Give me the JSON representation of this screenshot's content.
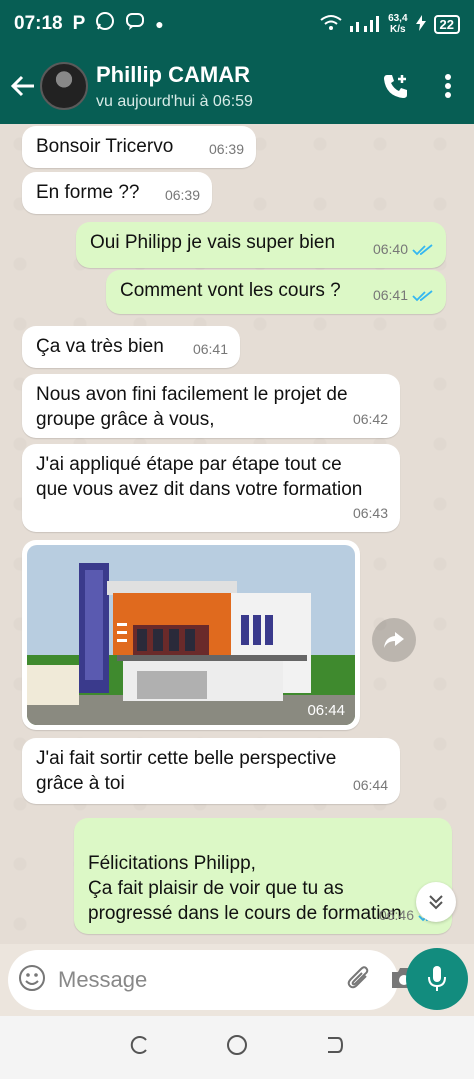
{
  "status_bar": {
    "time": "07:18",
    "speed_value": "63,4",
    "speed_unit": "K/s",
    "battery": "22"
  },
  "header": {
    "contact_name": "Phillip CAMAR",
    "last_seen": "vu aujourd'hui à 06:59"
  },
  "messages": [
    {
      "direction": "in",
      "text": "Bonsoir Tricervo",
      "time": "06:39"
    },
    {
      "direction": "in",
      "text": "En forme ??",
      "time": "06:39"
    },
    {
      "direction": "out",
      "text": "Oui Philipp je vais super bien",
      "time": "06:40",
      "status": "read"
    },
    {
      "direction": "out",
      "text": "Comment vont les cours ?",
      "time": "06:41",
      "status": "read"
    },
    {
      "direction": "in",
      "text": "Ça va très bien",
      "time": "06:41"
    },
    {
      "direction": "in",
      "text": "Nous avon fini facilement le projet de groupe grâce à vous,",
      "time": "06:42"
    },
    {
      "direction": "in",
      "text": "J'ai appliqué étape par étape tout ce que vous avez dit dans votre formation",
      "time": "06:43"
    },
    {
      "direction": "in",
      "type": "image",
      "time": "06:44"
    },
    {
      "direction": "in",
      "text": "J'ai fait sortir cette belle perspective grâce à toi",
      "time": "06:44"
    },
    {
      "direction": "out",
      "text": "Félicitations Philipp,\nÇa fait plaisir de voir que tu as progressé dans le cours de formation",
      "time": "06:46",
      "status": "read"
    }
  ],
  "input": {
    "placeholder": "Message"
  },
  "colors": {
    "header": "#075e54",
    "accent": "#128c7e",
    "outgoing_bubble": "#dcf8c6",
    "incoming_bubble": "#ffffff",
    "read_tick": "#34b7f1"
  },
  "icons": [
    "back-arrow-icon",
    "add-call-icon",
    "more-vert-icon",
    "forward-icon",
    "chevron-double-down-icon",
    "emoji-icon",
    "attach-icon",
    "camera-icon",
    "mic-icon",
    "recents-nav-icon",
    "home-nav-icon",
    "back-nav-icon"
  ]
}
